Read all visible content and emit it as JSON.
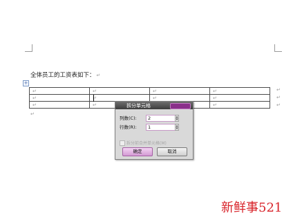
{
  "document": {
    "heading": "全体员工的工资表如下：",
    "return_mark": "↵",
    "table_handle": "+",
    "table": {
      "rows": [
        [
          "↵",
          "↵",
          "↵",
          "↵"
        ],
        [
          "↵",
          "↵",
          "↵",
          "↵"
        ],
        [
          "↵",
          "↵",
          "↵",
          "↵"
        ]
      ]
    }
  },
  "dialog": {
    "title": "拆分单元格",
    "columns_label": "列数(C):",
    "columns_value": "2",
    "rows_label": "行数(R):",
    "rows_value": "1",
    "merge_label": "拆分前合并单元格(M)",
    "ok_label": "确定",
    "cancel_label": "取消"
  },
  "watermark": "新鲜事521",
  "colors": {
    "accent": "#8a2f8a",
    "watermark": "#d8232a"
  }
}
